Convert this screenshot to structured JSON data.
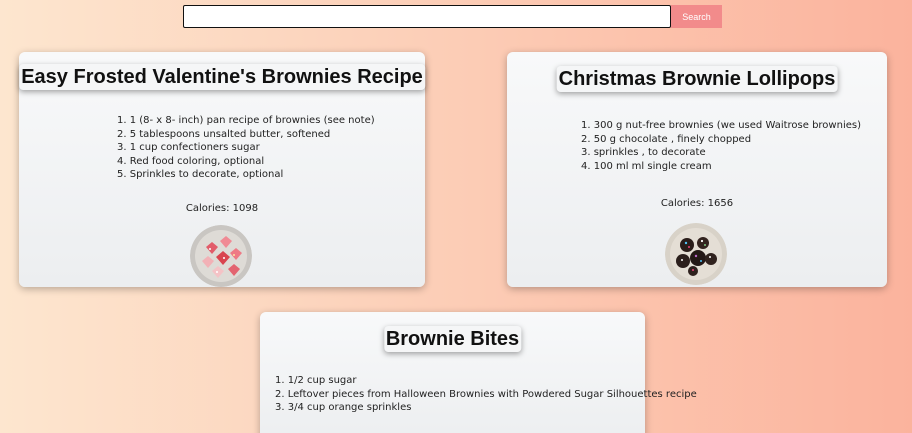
{
  "search": {
    "placeholder": "",
    "value": "",
    "button_label": "Search"
  },
  "recipes": [
    {
      "title": "Easy Frosted Valentine's Brownies Recipe",
      "ingredients": [
        "1. 1 (8- x 8- inch) pan recipe of brownies (see note)",
        "2. 5 tablespoons unsalted butter, softened",
        "3. 1 cup confectioners sugar",
        "4. Red food coloring, optional",
        "5. Sprinkles to decorate, optional"
      ],
      "calories": "Calories: 1098"
    },
    {
      "title": "Christmas Brownie Lollipops",
      "ingredients": [
        "1. 300 g nut-free brownies (we used Waitrose brownies)",
        "2. 50 g chocolate , finely chopped",
        "3. sprinkles , to decorate",
        "4. 100 ml ml single cream"
      ],
      "calories": "Calories: 1656"
    },
    {
      "title": "Brownie Bites",
      "ingredients": [
        "1. 1/2 cup sugar",
        "2. Leftover pieces from Halloween Brownies with Powdered Sugar Silhouettes recipe",
        "3. 3/4 cup orange sprinkles"
      ]
    }
  ],
  "colors": {
    "accent": "#f28b8b",
    "background_left": "#fde6cf",
    "background_right": "#fbb39d"
  }
}
